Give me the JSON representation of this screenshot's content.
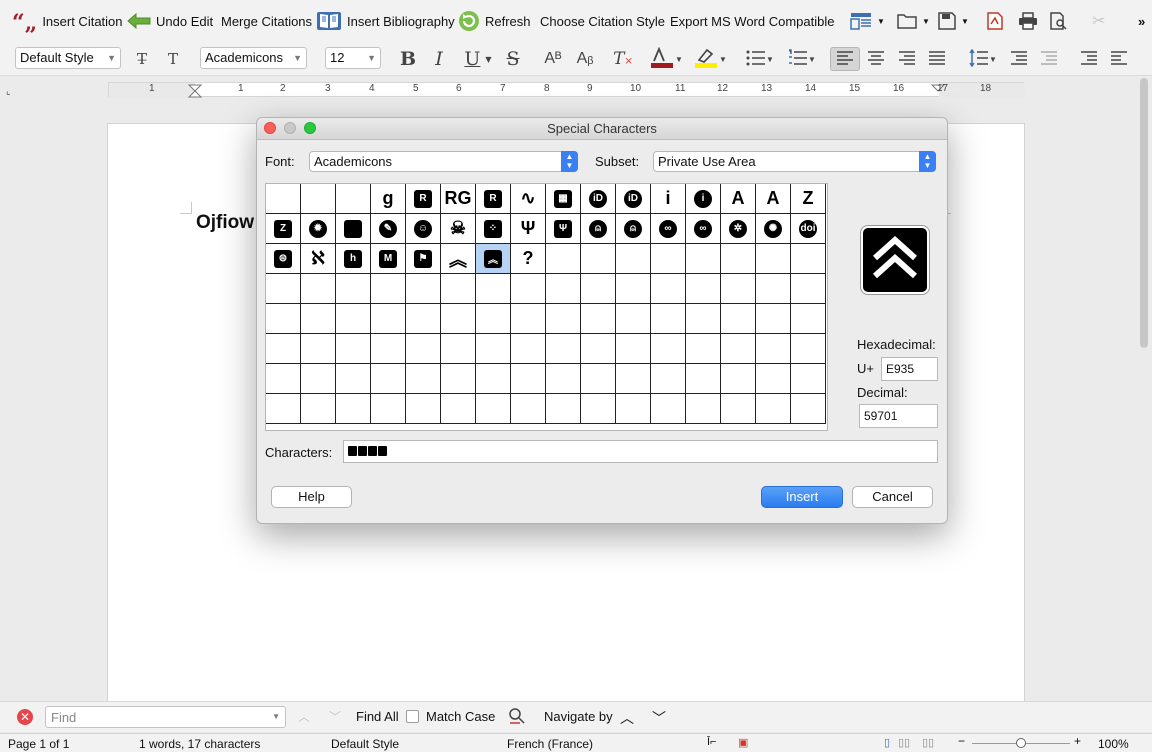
{
  "toolbar": {
    "insert_citation": "Insert Citation",
    "undo_edit": "Undo Edit",
    "merge_citations": "Merge Citations",
    "insert_bibliography": "Insert Bibliography",
    "refresh": "Refresh",
    "choose_citation_style": "Choose Citation Style",
    "export_word": "Export MS Word Compatible",
    "more": "»"
  },
  "format_bar": {
    "paragraph_style": "Default Style",
    "font_name": "Academicons",
    "font_size": "12"
  },
  "ruler": {
    "numbers": [
      "1",
      "1",
      "2",
      "3",
      "4",
      "5",
      "6",
      "7",
      "8",
      "9",
      "10",
      "11",
      "12",
      "13",
      "14",
      "15",
      "16",
      "17",
      "18"
    ]
  },
  "document": {
    "visible_text": "Ojfiow"
  },
  "dialog": {
    "title": "Special Characters",
    "font_label": "Font:",
    "font_value": "Academicons",
    "subset_label": "Subset:",
    "subset_value": "Private Use Area",
    "hex_label": "Hexadecimal:",
    "hex_prefix": "U+",
    "hex_value": "E935",
    "decimal_label": "Decimal:",
    "decimal_value": "59701",
    "characters_label": "Characters:",
    "help_button": "Help",
    "insert_button": "Insert",
    "cancel_button": "Cancel",
    "colors": {
      "close": "#fc5f57",
      "minimize": "#c8c8c8",
      "zoom": "#28c840",
      "accent": "#3b7ff5"
    }
  },
  "glyph_grid": {
    "row1": [
      "",
      "",
      "",
      "g",
      "r",
      "RG",
      "R",
      "mend",
      "ssrn",
      "iD",
      "iD",
      "i",
      "i",
      "A",
      "A",
      "Z"
    ],
    "row2": [
      "Z",
      "gear",
      "sq",
      "pen",
      "face",
      "bug",
      "dots",
      "Ψ",
      "Ψ",
      "oa",
      "oa",
      "∞",
      "∞",
      "cog",
      "ring",
      "doi"
    ],
    "row3": [
      "db",
      "tree",
      "h",
      "M",
      "flag",
      "chevron",
      "chevron",
      "?"
    ],
    "selected_index": 38,
    "selected_glyph": "chevron"
  },
  "find_bar": {
    "placeholder": "Find",
    "find_all": "Find All",
    "match_case": "Match Case",
    "navigate_by": "Navigate by"
  },
  "status_bar": {
    "page": "Page 1 of 1",
    "words": "1 words, 17 characters",
    "style": "Default Style",
    "language": "French (France)",
    "zoom": "100%"
  }
}
